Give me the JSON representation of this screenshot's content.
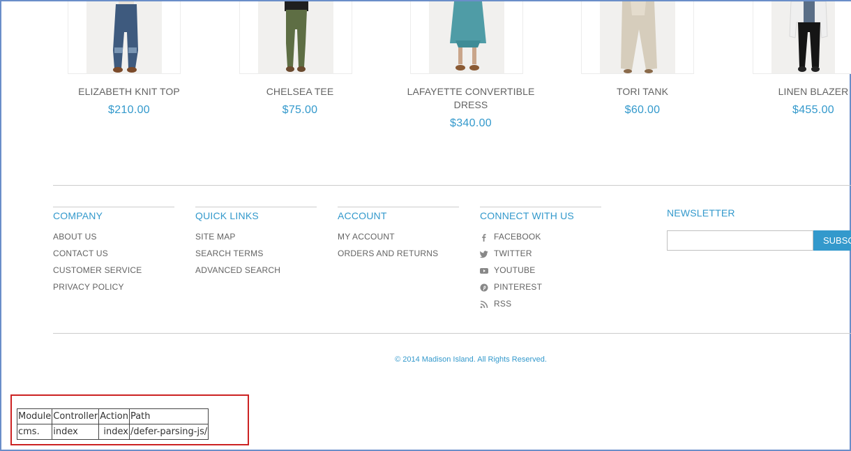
{
  "products": [
    {
      "name": "ELIZABETH KNIT TOP",
      "price": "$210.00"
    },
    {
      "name": "CHELSEA TEE",
      "price": "$75.00"
    },
    {
      "name": "LAFAYETTE CONVERTIBLE DRESS",
      "price": "$340.00"
    },
    {
      "name": "TORI TANK",
      "price": "$60.00"
    },
    {
      "name": "LINEN BLAZER",
      "price": "$455.00"
    }
  ],
  "footer": {
    "company": {
      "title": "COMPANY",
      "links": [
        "ABOUT US",
        "CONTACT US",
        "CUSTOMER SERVICE",
        "PRIVACY POLICY"
      ]
    },
    "quick_links": {
      "title": "QUICK LINKS",
      "links": [
        "SITE MAP",
        "SEARCH TERMS",
        "ADVANCED SEARCH"
      ]
    },
    "account": {
      "title": "ACCOUNT",
      "links": [
        "MY ACCOUNT",
        "ORDERS AND RETURNS"
      ]
    },
    "connect": {
      "title": "CONNECT WITH US",
      "links": [
        {
          "label": "FACEBOOK",
          "icon": "facebook-icon"
        },
        {
          "label": "TWITTER",
          "icon": "twitter-icon"
        },
        {
          "label": "YOUTUBE",
          "icon": "youtube-icon"
        },
        {
          "label": "PINTEREST",
          "icon": "pinterest-icon"
        },
        {
          "label": "RSS",
          "icon": "rss-icon"
        }
      ]
    },
    "newsletter": {
      "title": "NEWSLETTER",
      "input_value": "",
      "button_label": "SUBSCRIBE"
    },
    "copyright": "© 2014 Madison Island. All Rights Reserved."
  },
  "debug_table": {
    "headers": [
      "Module",
      "Controller",
      "Action",
      "Path"
    ],
    "row": [
      "cms.",
      "index",
      "index",
      "/defer-parsing-js/"
    ]
  },
  "colors": {
    "accent": "#3399cc",
    "text": "#636363",
    "highlight_box": "#cc2222",
    "window_border": "#6a8ec9"
  }
}
